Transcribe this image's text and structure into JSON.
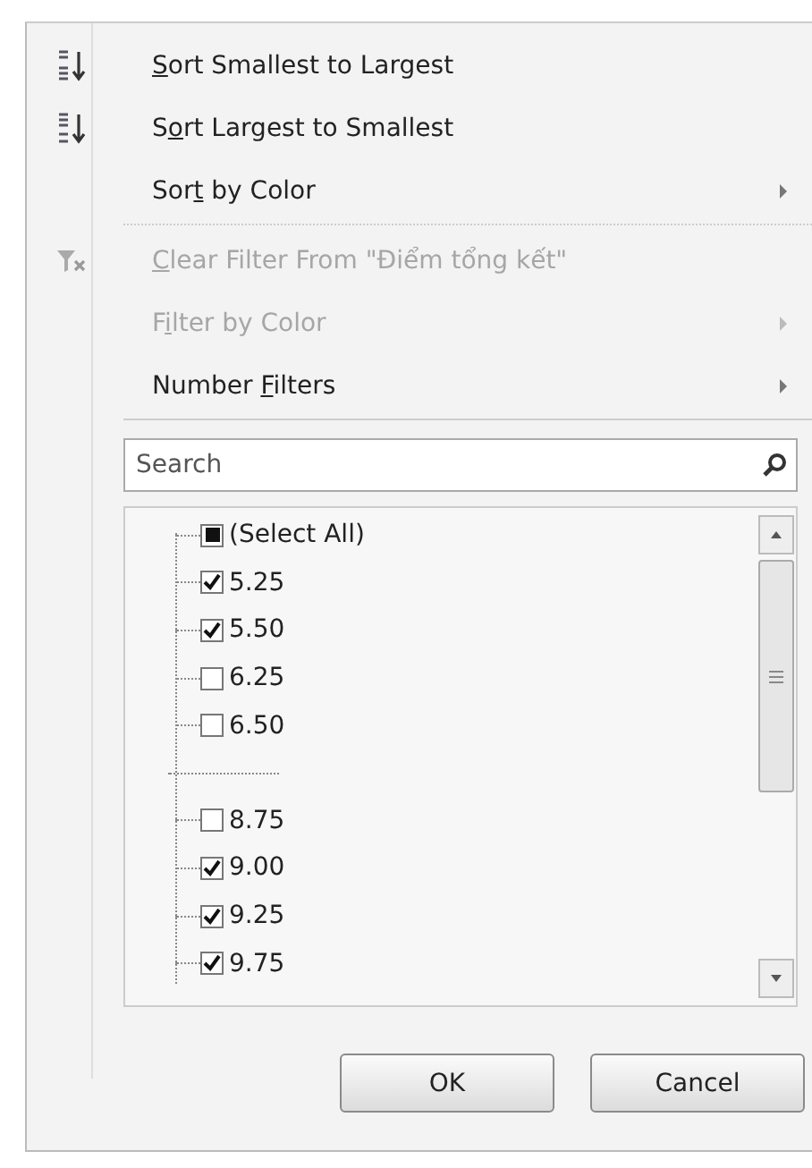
{
  "menu_items": [
    {
      "kind": "ascending",
      "label": {
        "key": "S",
        "after": "ort Smallest to Largest"
      },
      "disabled": false,
      "submenu": false,
      "divider_after": false
    },
    {
      "kind": "descending",
      "label": {
        "before": "S",
        "key": "o",
        "after": "rt Largest to Smallest"
      },
      "disabled": false,
      "submenu": false,
      "divider_after": false
    },
    {
      "kind": "plain",
      "label": {
        "before": "Sor",
        "key": "t",
        "after": " by Color"
      },
      "disabled": false,
      "submenu": true,
      "divider_after": true
    },
    {
      "kind": "clear",
      "label": {
        "key": "C",
        "after": "lear Filter From \"Điểm tổng kết\""
      },
      "disabled": true,
      "submenu": false,
      "divider_after": false
    },
    {
      "kind": "plain",
      "label": {
        "before": "F",
        "key": "i",
        "after": "lter by Color"
      },
      "disabled": true,
      "submenu": true,
      "divider_after": false
    },
    {
      "kind": "plain",
      "label": {
        "before": "Number ",
        "key": "F",
        "after": "ilters"
      },
      "disabled": false,
      "submenu": true,
      "divider_after": true
    }
  ],
  "search": {
    "placeholder": "Search"
  },
  "values": [
    {
      "kind": "select_all",
      "label": "(Select All)",
      "partial": true
    },
    {
      "kind": "checkbox",
      "label": "5.25",
      "checked": true
    },
    {
      "kind": "checkbox",
      "label": "5.50",
      "checked": true
    },
    {
      "kind": "checkbox",
      "label": "6.25",
      "checked": false
    },
    {
      "kind": "checkbox",
      "label": "6.50",
      "checked": false
    },
    {
      "kind": "gap"
    },
    {
      "kind": "checkbox",
      "label": "8.75",
      "checked": false
    },
    {
      "kind": "checkbox",
      "label": "9.00",
      "checked": true
    },
    {
      "kind": "checkbox",
      "label": "9.25",
      "checked": true
    },
    {
      "kind": "checkbox",
      "label": "9.75",
      "checked": true
    }
  ],
  "buttons": [
    "OK",
    "Cancel"
  ]
}
